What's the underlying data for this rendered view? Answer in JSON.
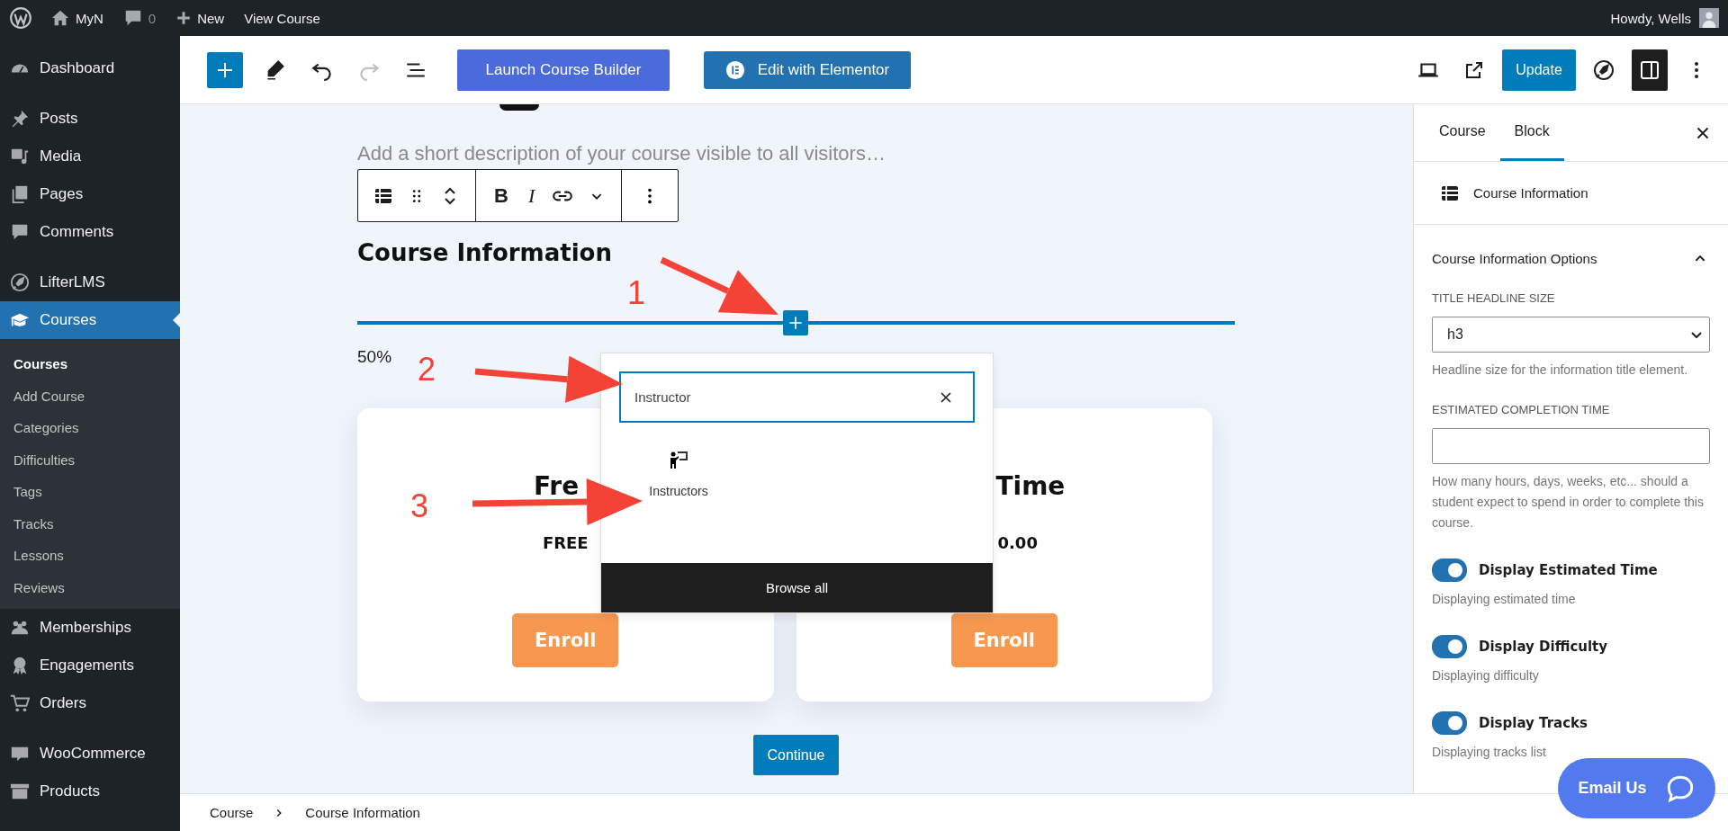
{
  "admin_bar": {
    "items": [
      {
        "kind": "logo"
      },
      {
        "kind": "home",
        "label": "MyN"
      },
      {
        "kind": "comments",
        "label": "0"
      },
      {
        "kind": "new",
        "label": "New"
      },
      {
        "kind": "link",
        "label": "View Course"
      }
    ],
    "greeting": "Howdy, Wells"
  },
  "sidebar": {
    "groups": [
      [
        {
          "kind": "dashboard",
          "label": "Dashboard",
          "selected": false
        }
      ],
      [
        {
          "kind": "posts",
          "label": "Posts",
          "selected": false
        },
        {
          "kind": "media",
          "label": "Media",
          "selected": false
        },
        {
          "kind": "pages",
          "label": "Pages",
          "selected": false
        },
        {
          "kind": "comments",
          "label": "Comments",
          "selected": false
        }
      ],
      [
        {
          "kind": "lifter",
          "label": "LifterLMS",
          "selected": false
        },
        {
          "kind": "courses",
          "label": "Courses",
          "selected": true,
          "children": [
            {
              "label": "Courses",
              "selected": true
            },
            {
              "label": "Add Course",
              "selected": false
            },
            {
              "label": "Categories",
              "selected": false
            },
            {
              "label": "Difficulties",
              "selected": false
            },
            {
              "label": "Tags",
              "selected": false
            },
            {
              "label": "Tracks",
              "selected": false
            },
            {
              "label": "Lessons",
              "selected": false
            },
            {
              "label": "Reviews",
              "selected": false
            }
          ]
        },
        {
          "kind": "memberships",
          "label": "Memberships",
          "selected": false
        },
        {
          "kind": "engagements",
          "label": "Engagements",
          "selected": false
        },
        {
          "kind": "orders",
          "label": "Orders",
          "selected": false
        }
      ],
      [
        {
          "kind": "woo",
          "label": "WooCommerce",
          "selected": false
        },
        {
          "kind": "products",
          "label": "Products",
          "selected": false
        }
      ]
    ]
  },
  "toolbar": {
    "tools": [
      {
        "kind": "pencil",
        "disabled": false
      },
      {
        "kind": "undo",
        "disabled": false
      },
      {
        "kind": "redo",
        "disabled": true
      },
      {
        "kind": "list",
        "disabled": false
      }
    ],
    "launch_button": "Launch Course Builder",
    "elementor_button": "Edit with Elementor",
    "update_button": "Update",
    "settings_pressed": true
  },
  "canvas": {
    "description_placeholder": "Add a short description of your course visible to all visitors…",
    "block_toolbar": {
      "bold": "B",
      "italic": "I"
    },
    "heading": "Course Information",
    "progress_text": "50%",
    "inserter": {
      "search": {
        "value": "Instructor"
      },
      "results": [
        {
          "label": "Instructors"
        }
      ],
      "browse_all": "Browse all"
    },
    "cards": [
      {
        "title": "Fre",
        "price": "FREE",
        "button": "Enroll"
      },
      {
        "title": "Time",
        "price": "0.00",
        "button": "Enroll"
      }
    ],
    "continue_button": "Continue"
  },
  "annotations": [
    {
      "label": "1"
    },
    {
      "label": "2"
    },
    {
      "label": "3"
    }
  ],
  "breadcrumb": [
    "Course",
    "Course Information"
  ],
  "settings_panel": {
    "tabs": [
      {
        "label": "Course",
        "selected": false
      },
      {
        "label": "Block",
        "selected": true
      }
    ],
    "block_title": "Course Information",
    "section": {
      "title": "Course Information Options",
      "expanded": true,
      "fields": [
        {
          "kind": "select",
          "label": "TITLE HEADLINE SIZE",
          "value": "h3",
          "help": "Headline size for the information title element."
        },
        {
          "kind": "text",
          "label": "ESTIMATED COMPLETION TIME",
          "help": "How many hours, days, weeks, etc... should a student expect to spend in order to complete this course."
        }
      ],
      "toggles": [
        {
          "label": "Display Estimated Time",
          "on": true,
          "help": "Displaying estimated time"
        },
        {
          "label": "Display Difficulty",
          "on": true,
          "help": "Displaying difficulty"
        },
        {
          "label": "Display Tracks",
          "on": true,
          "help": "Displaying tracks list"
        }
      ]
    }
  },
  "chat_button": "Email Us"
}
